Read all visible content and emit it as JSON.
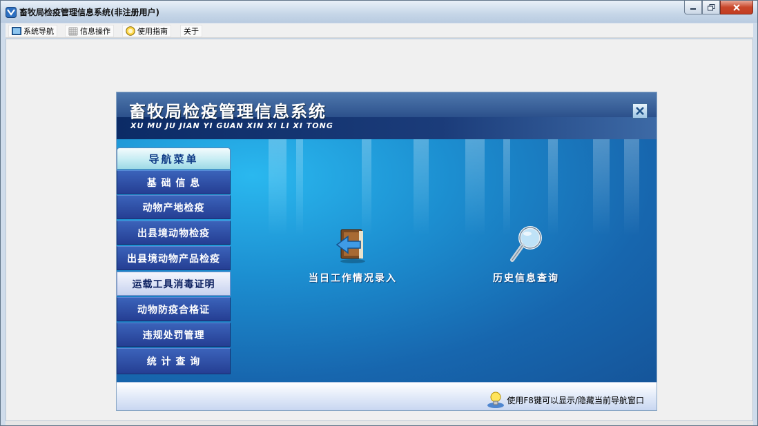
{
  "window": {
    "title": "畜牧局检疫管理信息系统(非注册用户)"
  },
  "menubar": {
    "items": [
      {
        "label": "系统导航",
        "icon": "monitor-icon"
      },
      {
        "label": "信息操作",
        "icon": "grid-icon"
      },
      {
        "label": "使用指南",
        "icon": "help-icon"
      },
      {
        "label": "关于",
        "icon": ""
      }
    ]
  },
  "panel": {
    "title": "畜牧局检疫管理信息系统",
    "subtitle": "XU MU JU JIAN YI GUAN  XIN XI LI XI TONG",
    "nav_header": "导航菜单",
    "nav_items": [
      {
        "label": "基 础 信 息",
        "active": false
      },
      {
        "label": "动物产地检疫",
        "active": false
      },
      {
        "label": "出县境动物检疫",
        "active": false
      },
      {
        "label": "出县境动物产品检疫",
        "active": false
      },
      {
        "label": "运载工具消毒证明",
        "active": true
      },
      {
        "label": "动物防疫合格证",
        "active": false
      },
      {
        "label": "违规处罚管理",
        "active": false
      },
      {
        "label": "统 计 查 询",
        "active": false
      }
    ],
    "actions": [
      {
        "label": "当日工作情况录入",
        "icon": "book-arrow-icon"
      },
      {
        "label": "历史信息查询",
        "icon": "magnifier-icon"
      }
    ],
    "footer_hint": "使用F8键可以显示/隐藏当前导航窗口"
  },
  "colors": {
    "nav_item": "#2d4ea6",
    "nav_active": "#dfe6f7",
    "stage": "#1c8ed0",
    "header": "#1b3c7a"
  }
}
